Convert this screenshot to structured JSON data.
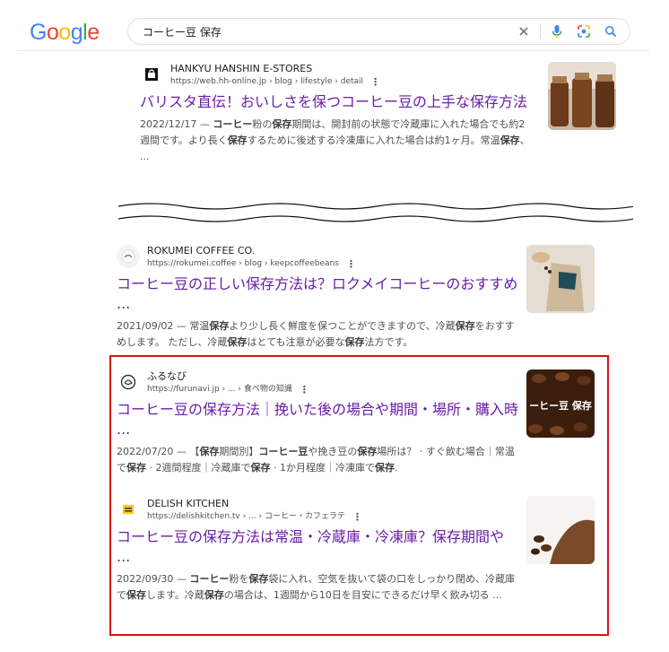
{
  "logo": {
    "text": "Google"
  },
  "search": {
    "query": "コーヒー豆 保存"
  },
  "results": [
    {
      "site": "HANKYU HANSHIN E-STORES",
      "url": "https://web.hh-online.jp › blog › lifestyle › detail",
      "title": "バリスタ直伝！おいしさを保つコーヒー豆の上手な保存方法",
      "snippet": "2022/12/17 — コーヒー粉の保存期間は、開封前の状態で冷蔵庫に入れた場合でも約2週間です。より長く保存するために後述する冷凍庫に入れた場合は約1ヶ月。常温保存、 ..."
    },
    {
      "site": "ROKUMEI COFFEE CO.",
      "url": "https://rokumei.coffee › blog › keepcoffeebeans",
      "title": "コーヒー豆の正しい保存方法は？ロクメイコーヒーのおすすめ ...",
      "snippet": "2021/09/02 — 常温保存より少し長く鮮度を保つことができますので、冷蔵保存をおすすめします。 ただし、冷蔵保存はとても注意が必要な保存法方です。"
    },
    {
      "site": "ふるなび",
      "url": "https://furunavi.jp › ... › 食べ物の知識",
      "title": "コーヒー豆の保存方法｜挽いた後の場合や期間・場所・購入時 ...",
      "snippet": "2022/07/20 — 【保存期間別】コーヒー豆や挽き豆の保存場所は？ · すぐ飲む場合｜常温で保存 · 2週間程度｜冷蔵庫で保存 · 1か月程度｜冷凍庫で保存.",
      "thumb_text": "ーヒー豆 保存"
    },
    {
      "site": "DELISH KITCHEN",
      "url": "https://delishkitchen.tv › ... › コーヒー・カフェラテ",
      "title": "コーヒー豆の保存方法は常温・冷蔵庫・冷凍庫？保存期間や ...",
      "snippet": "2022/09/30 — コーヒー粉を保存袋に入れ、空気を抜いて袋の口をしっかり閉め、冷蔵庫で保存します。冷蔵保存の場合は、1週間から10日を目安にできるだけ早く飲み切る ..."
    }
  ],
  "colors": {
    "title_visited": "#681da8",
    "highlight_box": "#d7141a"
  },
  "icons": [
    "clear-icon",
    "mic-icon",
    "lens-icon",
    "search-icon",
    "kebab-icon"
  ]
}
